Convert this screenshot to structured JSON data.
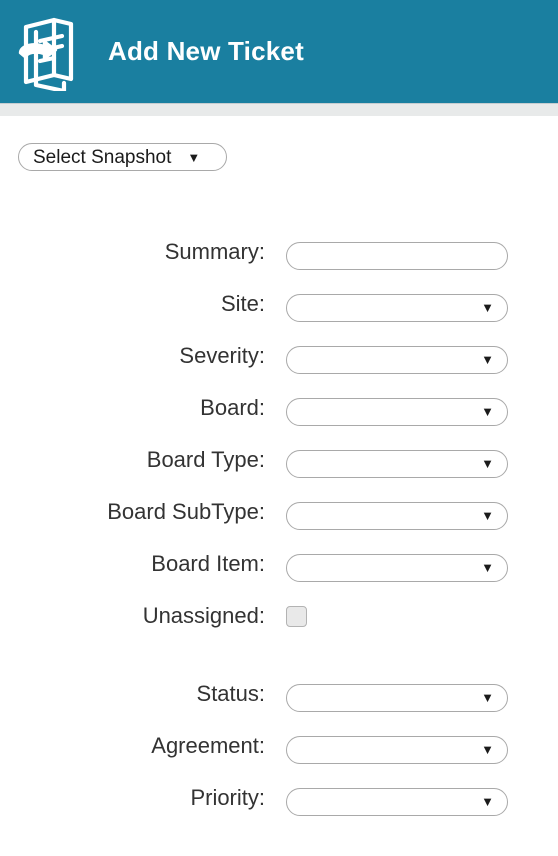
{
  "header": {
    "title": "Add New Ticket",
    "icon": "ticket-book-refresh-icon",
    "background_color": "#1a7fa0",
    "title_color": "#ffffff"
  },
  "snapshot": {
    "label": "Select Snapshot",
    "caret": "▼",
    "icon": "chevron-down-icon"
  },
  "form": {
    "fields": [
      {
        "label": "Summary:",
        "type": "text",
        "value": "",
        "caret": ""
      },
      {
        "label": "Site:",
        "type": "select",
        "value": "",
        "caret": "▼"
      },
      {
        "label": "Severity:",
        "type": "select",
        "value": "",
        "caret": "▼"
      },
      {
        "label": "Board:",
        "type": "select",
        "value": "",
        "caret": "▼"
      },
      {
        "label": "Board Type:",
        "type": "select",
        "value": "",
        "caret": "▼"
      },
      {
        "label": "Board SubType:",
        "type": "select",
        "value": "",
        "caret": "▼"
      },
      {
        "label": "Board Item:",
        "type": "select",
        "value": "",
        "caret": "▼"
      },
      {
        "label": "Unassigned:",
        "type": "checkbox",
        "value": "",
        "caret": ""
      },
      {
        "label": "Status:",
        "type": "select",
        "value": "",
        "caret": "▼",
        "spaced": true
      },
      {
        "label": "Agreement:",
        "type": "select",
        "value": "",
        "caret": "▼"
      },
      {
        "label": "Priority:",
        "type": "select",
        "value": "",
        "caret": "▼"
      }
    ]
  },
  "colors": {
    "accent": "#1a7fa0",
    "under_bar": "#e8eaea",
    "field_border": "#a9a9a9",
    "label_text": "#333333",
    "checkbox_fill": "#e9e9e9"
  }
}
